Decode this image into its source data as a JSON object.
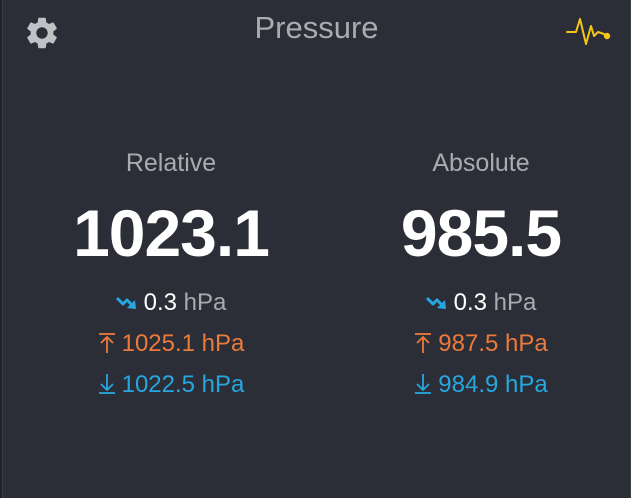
{
  "header": {
    "title": "Pressure",
    "settings_icon": "gear-icon",
    "graph_icon": "pulse-graph-icon"
  },
  "relative": {
    "label": "Relative",
    "value": "1023.1",
    "trend": "0.3",
    "trend_unit": "hPa",
    "high": "1025.1 hPa",
    "low": "1022.5 hPa"
  },
  "absolute": {
    "label": "Absolute",
    "value": "985.5",
    "trend": "0.3",
    "trend_unit": "hPa",
    "high": "987.5 hPa",
    "low": "984.9 hPa"
  },
  "colors": {
    "background": "#2b2e36",
    "label": "#a9abaf",
    "value": "#ffffff",
    "high": "#ec7a3b",
    "low": "#27a7e0",
    "trend_icon": "#27a7e0",
    "graph_icon": "#f5c518"
  }
}
